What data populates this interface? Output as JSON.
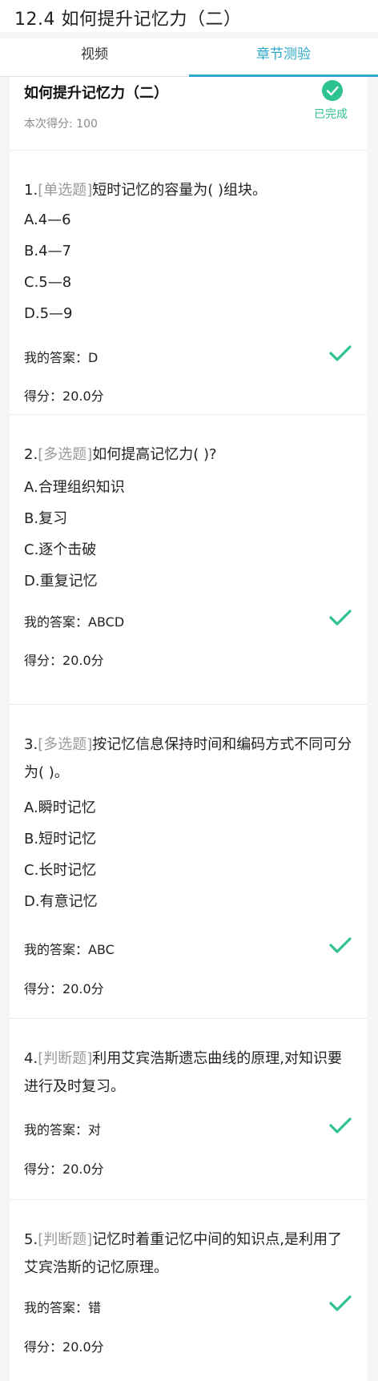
{
  "header": {
    "title": "12.4 如何提升记忆力（二）"
  },
  "tabs": [
    {
      "label": "视频"
    },
    {
      "label": "章节测验"
    }
  ],
  "summary": {
    "title": "如何提升记忆力（二）",
    "score_text": "本次得分: 100",
    "status": "已完成"
  },
  "answer_label": "我的答案：",
  "score_label": "得分：",
  "questions": [
    {
      "num": "1.",
      "type": "[单选题]",
      "text": "短时记忆的容量为( )组块。",
      "options": [
        "A.4—6",
        "B.4—7",
        "C.5—8",
        "D.5—9"
      ],
      "answer": "D",
      "points": "20.0分"
    },
    {
      "num": "2.",
      "type": "[多选题]",
      "text": "如何提高记忆力( )?",
      "options": [
        "A.合理组织知识",
        "B.复习",
        "C.逐个击破",
        "D.重复记忆"
      ],
      "answer": "ABCD",
      "points": "20.0分"
    },
    {
      "num": "3.",
      "type": "[多选题]",
      "text": "按记忆信息保持时间和编码方式不同可分为( )。",
      "options": [
        "A.瞬时记忆",
        "B.短时记忆",
        "C.长时记忆",
        "D.有意记忆"
      ],
      "answer": "ABC",
      "points": "20.0分"
    },
    {
      "num": "4.",
      "type": "[判断题]",
      "text": "利用艾宾浩斯遗忘曲线的原理,对知识要进行及时复习。",
      "options": [],
      "answer": "对",
      "points": "20.0分"
    },
    {
      "num": "5.",
      "type": "[判断题]",
      "text": "记忆时着重记忆中间的知识点,是利用了艾宾浩斯的记忆原理。",
      "options": [],
      "answer": "错",
      "points": "20.0分"
    }
  ],
  "colors": {
    "accent": "#2aa7c9",
    "success": "#2ec28e"
  }
}
